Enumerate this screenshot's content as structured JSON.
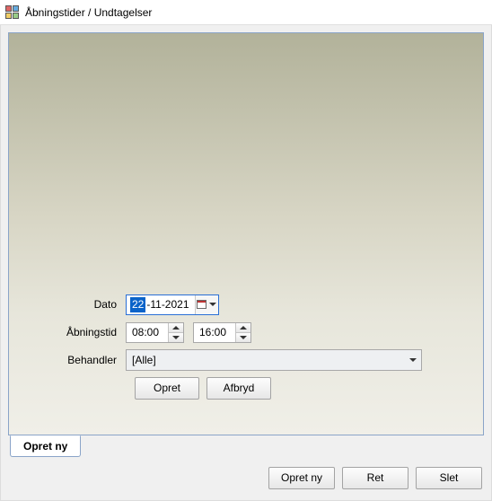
{
  "window": {
    "title": "Åbningstider / Undtagelser"
  },
  "tab": {
    "label": "Opret ny"
  },
  "form": {
    "date_label": "Dato",
    "date_day": "22",
    "date_rest": "-11-2021",
    "opening_label": "Åbningstid",
    "opening_from": "08:00",
    "opening_to": "16:00",
    "handler_label": "Behandler",
    "handler_value": "[Alle]"
  },
  "inner_buttons": {
    "create": "Opret",
    "cancel": "Afbryd"
  },
  "bottom_buttons": {
    "create_new": "Opret ny",
    "edit": "Ret",
    "delete": "Slet"
  }
}
